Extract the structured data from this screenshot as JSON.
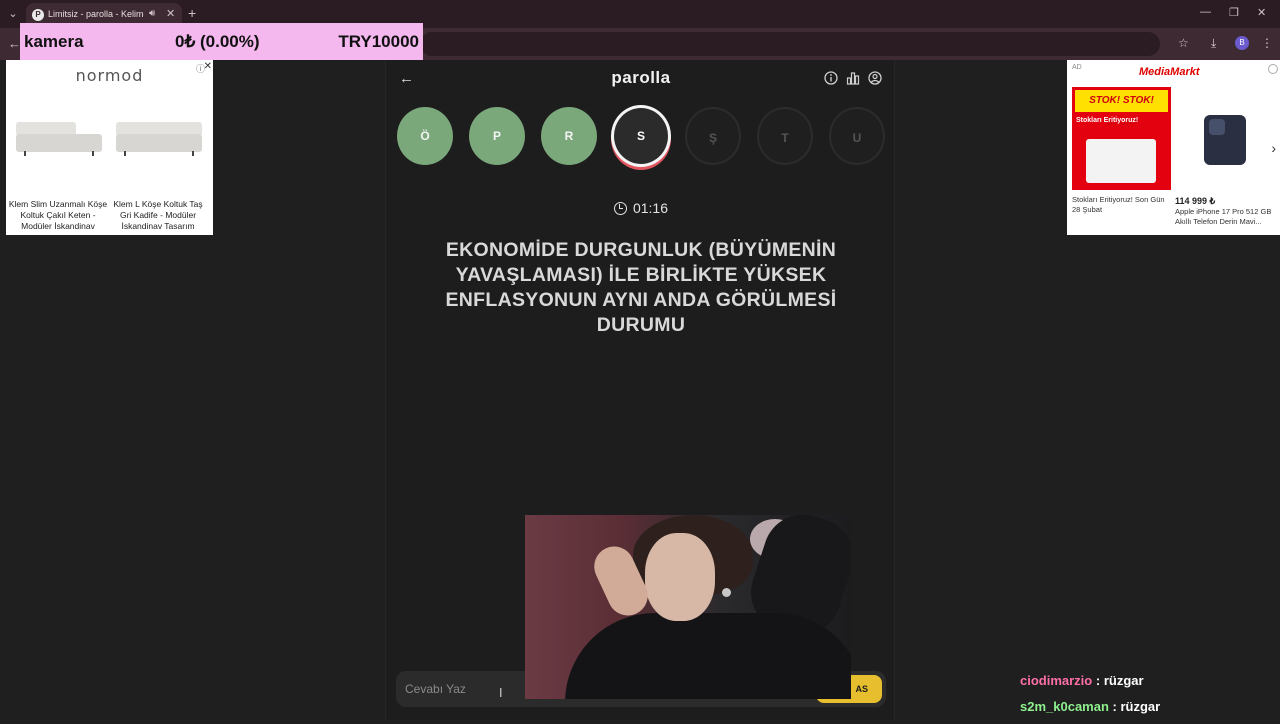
{
  "browser": {
    "tab_title": "Limitsiz - parolla - Kelime o",
    "favicon_letter": "P",
    "new_tab_label": "+",
    "profile_initial": "B"
  },
  "overlay": {
    "stock_name": "kamera",
    "stock_change": "0₺ (0.00%)",
    "stock_value": "TRY10000",
    "background": "#f4b8ee"
  },
  "ad_left": {
    "brand": "normod",
    "products": [
      {
        "caption": "Klem Slim Uzanmalı Köşe Koltuk Çakıl Keten - Modüler İskandinav"
      },
      {
        "caption": "Klem L Köşe Koltuk Taş Gri Kadife - Modüler İskandinav Tasarım"
      }
    ]
  },
  "ad_right": {
    "label": "AD",
    "brand": "MediaMarkt",
    "promo_headline": "STOK! STOK! STOK!",
    "promo_subline": "Stokları Eritiyoruz!",
    "left_text": "Stokları Eritiyoruz! Son Gün 28 Şubat",
    "price": "114 999 ₺",
    "right_text": "Apple iPhone 17 Pro 512 GB Akıllı Telefon Derin Mavi..."
  },
  "game": {
    "title": "parolla",
    "letters": [
      {
        "char": "Ö",
        "state": "done"
      },
      {
        "char": "P",
        "state": "done"
      },
      {
        "char": "R",
        "state": "done"
      },
      {
        "char": "S",
        "state": "current"
      },
      {
        "char": "Ş",
        "state": "todo"
      },
      {
        "char": "T",
        "state": "todo"
      },
      {
        "char": "U",
        "state": "todo"
      }
    ],
    "timer": "01:16",
    "question": "EKONOMİDE DURGUNLUK (BÜYÜMENİN YAVAŞLAMASI) İLE BİRLİKTE YÜKSEK ENFLASYONUN AYNI ANDA GÖRÜLMESİ DURUMU",
    "answer_placeholder": "Cevabı Yaz",
    "pass_label": "AS",
    "colors": {
      "done": "#7aa87b",
      "current_ring": "#e05560",
      "pass": "#e6be2e"
    }
  },
  "chat": [
    {
      "user": "ciodimarzio",
      "color": "#ff6fa8",
      "message": ": rüzgar"
    },
    {
      "user": "s2m_k0caman",
      "color": "#8ef08e",
      "message": ": rüzgar"
    }
  ]
}
